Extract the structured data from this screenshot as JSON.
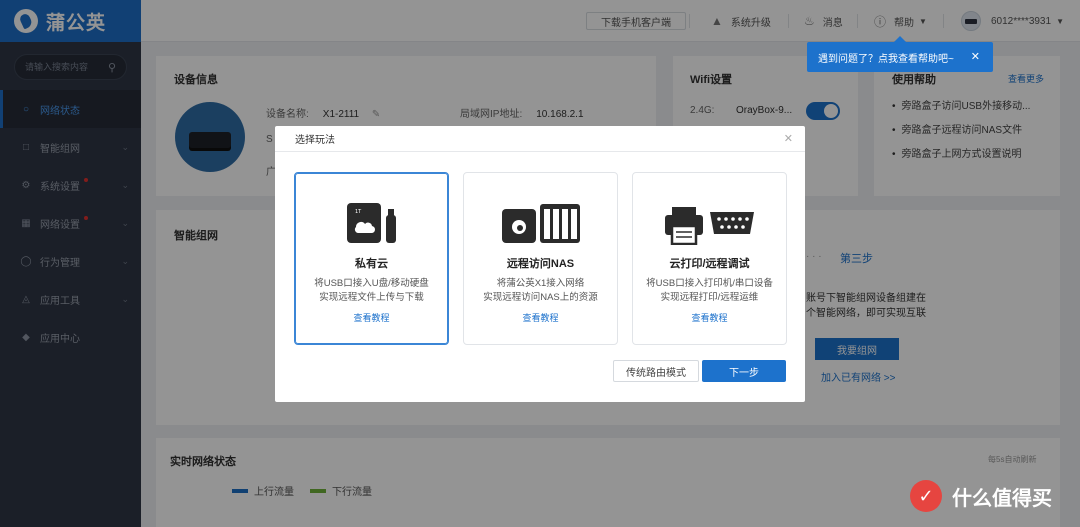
{
  "app": {
    "logo_text": "蒲公英"
  },
  "sidebar": {
    "search_placeholder": "请输入搜索内容",
    "items": [
      {
        "label": "网络状态",
        "icon": "network-status-icon",
        "active": true
      },
      {
        "label": "智能组网",
        "icon": "smart-network-icon"
      },
      {
        "label": "系统设置",
        "icon": "system-settings-icon",
        "badge": true
      },
      {
        "label": "网络设置",
        "icon": "network-settings-icon",
        "badge": true
      },
      {
        "label": "行为管理",
        "icon": "behavior-icon"
      },
      {
        "label": "应用工具",
        "icon": "tools-icon"
      },
      {
        "label": "应用中心",
        "icon": "app-center-icon"
      }
    ]
  },
  "topbar": {
    "download_label": "下载手机客户端",
    "upgrade_label": "系统升级",
    "messages_label": "消息",
    "help_label": "帮助",
    "account": "6012****3931"
  },
  "tooltip": {
    "text": "遇到问题了？点我查看帮助吧~"
  },
  "device_info": {
    "title": "设备信息",
    "name_label": "设备名称:",
    "name_value": "X1-2111",
    "lan_ip_label": "局域网IP地址:",
    "lan_ip_value": "10.168.2.1",
    "partial_s": "S",
    "partial_guang": "广"
  },
  "wifi": {
    "title": "Wifi设置",
    "band": "2.4G:",
    "ssid": "OrayBox-9...",
    "enabled": true
  },
  "usage_help": {
    "title": "使用帮助",
    "more_label": "查看更多",
    "items": [
      "旁路盒子访问USB外接移动...",
      "旁路盒子远程访问NAS文件",
      "旁路盒子上网方式设置说明"
    ]
  },
  "smart_network": {
    "title": "智能组网",
    "dots": "· · ·",
    "step3": "第三步",
    "line1": "账号下智能组网设备组建在",
    "line2": "个智能网络，即可实现互联",
    "my_network_btn": "我要组网",
    "join_link": "加入已有网络 >>"
  },
  "realtime": {
    "title": "实时网络状态",
    "refresh_note": "每5s自动刷新",
    "legend": [
      {
        "label": "上行流量",
        "color": "#1d6fc5"
      },
      {
        "label": "下行流量",
        "color": "#6fb13a"
      }
    ]
  },
  "modal": {
    "title": "选择玩法",
    "options": [
      {
        "title": "私有云",
        "desc1": "将USB口接入U盘/移动硬盘",
        "desc2": "实现远程文件上传与下载",
        "link": "查看教程",
        "selected": true,
        "icon": "private-cloud-icon"
      },
      {
        "title": "远程访问NAS",
        "desc1": "将蒲公英X1接入网络",
        "desc2": "实现远程访问NAS上的资源",
        "link": "查看教程",
        "selected": false,
        "icon": "nas-icon"
      },
      {
        "title": "云打印/远程调试",
        "desc1": "将USB口接入打印机/串口设备",
        "desc2": "实现远程打印/远程运维",
        "link": "查看教程",
        "selected": false,
        "icon": "printer-icon"
      }
    ],
    "traditional_label": "传统路由模式",
    "next_label": "下一步"
  },
  "watermark": {
    "text": "什么值得买"
  }
}
